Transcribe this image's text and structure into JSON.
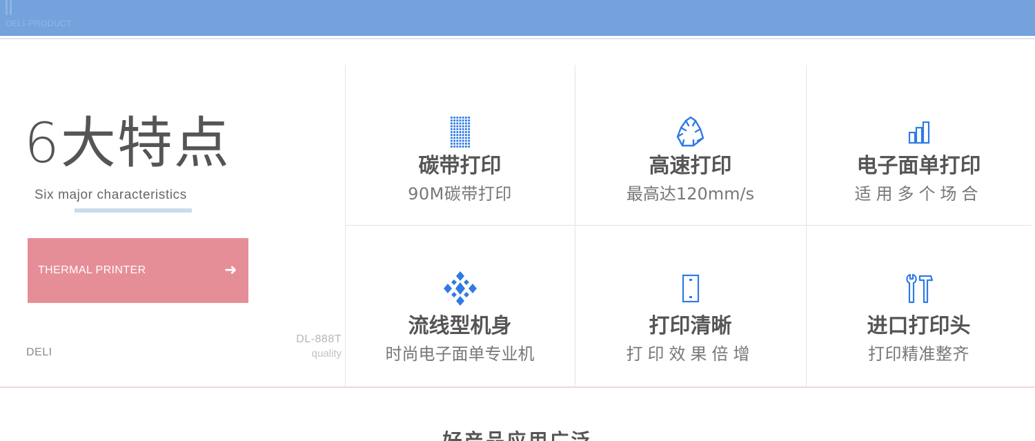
{
  "banner": {
    "subtext": "DELI-PRODUCT",
    "color": "#73a2dd"
  },
  "hero": {
    "title": "6大特点",
    "subtitle": "Six major characteristics",
    "cta": {
      "label": "THERMAL PRINTER",
      "arrow": "➜",
      "color": "#e68e97"
    },
    "brand": "DELI",
    "model_code": "DL-888T",
    "model_quality": "quality"
  },
  "features": [
    {
      "icon": "ribbon-grid-icon",
      "title": "碳带打印",
      "desc": "90M碳带打印"
    },
    {
      "icon": "recycle-icon",
      "title": "高速打印",
      "desc": "最高达120mm/s"
    },
    {
      "icon": "bar-chart-icon",
      "title": "电子面单打印",
      "desc": "适用多个场合"
    },
    {
      "icon": "diamond-cluster-icon",
      "title": "流线型机身",
      "desc": "时尚电子面单专业机"
    },
    {
      "icon": "print-frame-icon",
      "title": "打印清晰",
      "desc": "打印效果倍增"
    },
    {
      "icon": "tools-icon",
      "title": "进口打印头",
      "desc": "打印精准整齐"
    }
  ],
  "icon_color": "#2f7ae5",
  "bottom_heading": "好产品应用广泛"
}
